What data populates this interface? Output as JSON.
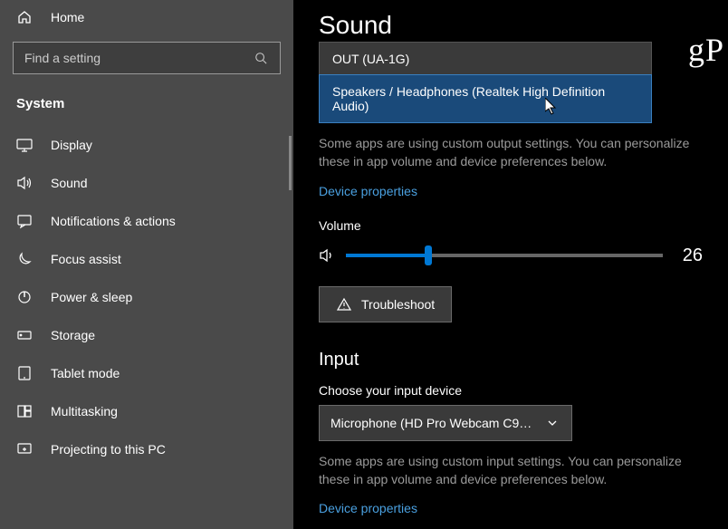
{
  "sidebar": {
    "home": "Home",
    "search_placeholder": "Find a setting",
    "section": "System",
    "items": [
      {
        "label": "Display",
        "icon": "display-icon"
      },
      {
        "label": "Sound",
        "icon": "sound-icon"
      },
      {
        "label": "Notifications & actions",
        "icon": "notifications-icon"
      },
      {
        "label": "Focus assist",
        "icon": "focus-icon"
      },
      {
        "label": "Power & sleep",
        "icon": "power-icon"
      },
      {
        "label": "Storage",
        "icon": "storage-icon"
      },
      {
        "label": "Tablet mode",
        "icon": "tablet-icon"
      },
      {
        "label": "Multitasking",
        "icon": "multitasking-icon"
      },
      {
        "label": "Projecting to this PC",
        "icon": "projecting-icon"
      }
    ]
  },
  "main": {
    "title": "Sound",
    "output_dropdown": {
      "options": [
        "OUT (UA-1G)",
        "Speakers / Headphones (Realtek High Definition Audio)"
      ],
      "highlighted_index": 1
    },
    "output_helper": "Some apps are using custom output settings. You can personalize these in app volume and device preferences below.",
    "device_properties": "Device properties",
    "volume_label": "Volume",
    "volume_value": "26",
    "troubleshoot": "Troubleshoot",
    "input_heading": "Input",
    "input_label": "Choose your input device",
    "input_selected": "Microphone (HD Pro Webcam C9…",
    "input_helper": "Some apps are using custom input settings. You can personalize these in app volume and device preferences below."
  },
  "watermark": "gP"
}
